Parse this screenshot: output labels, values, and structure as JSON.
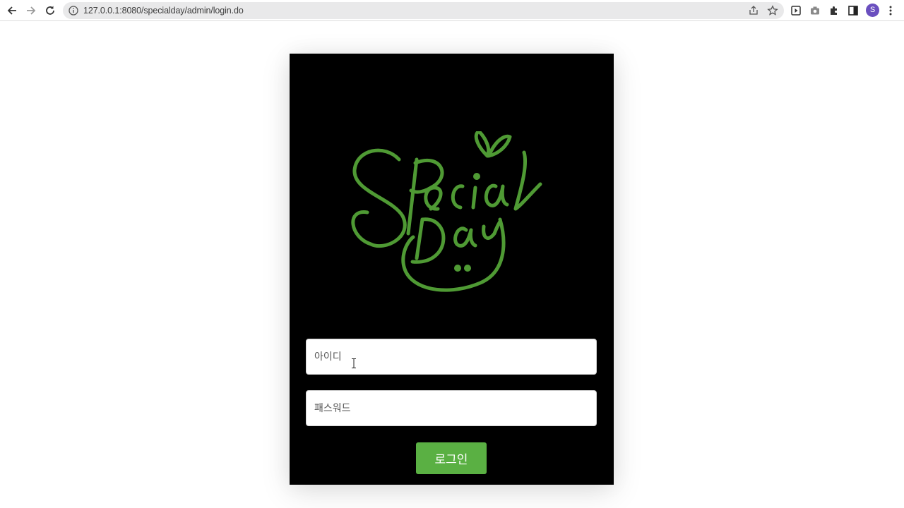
{
  "browser": {
    "url": "127.0.0.1:8080/specialday/admin/login.do",
    "profile_initial": "S"
  },
  "login": {
    "id_placeholder": "아이디",
    "password_placeholder": "패스워드",
    "button_label": "로그인"
  },
  "logo": {
    "text": "Special Day",
    "color": "#4f9a34"
  },
  "colors": {
    "card_background": "#000000",
    "button": "#5ab043"
  }
}
